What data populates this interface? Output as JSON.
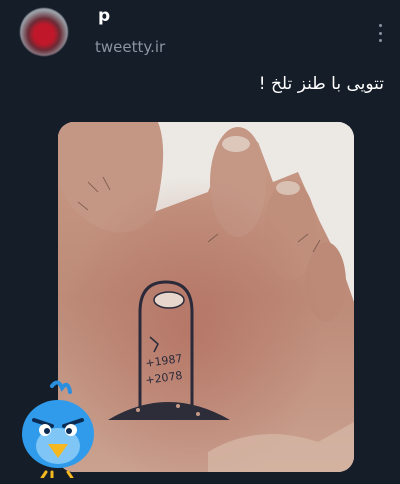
{
  "tweet": {
    "user_name": "p",
    "handle": "tweetty.ir",
    "text": "تتویی با طنز تلخ !"
  },
  "image": {
    "tattoo_line1": "+1987",
    "tattoo_line2": "+2078"
  },
  "icons": {
    "more": "more-vertical-icon",
    "mascot": "blue-bird-mascot-icon"
  },
  "colors": {
    "background": "#151d29",
    "text": "#ffffff",
    "muted": "#8a939f"
  }
}
